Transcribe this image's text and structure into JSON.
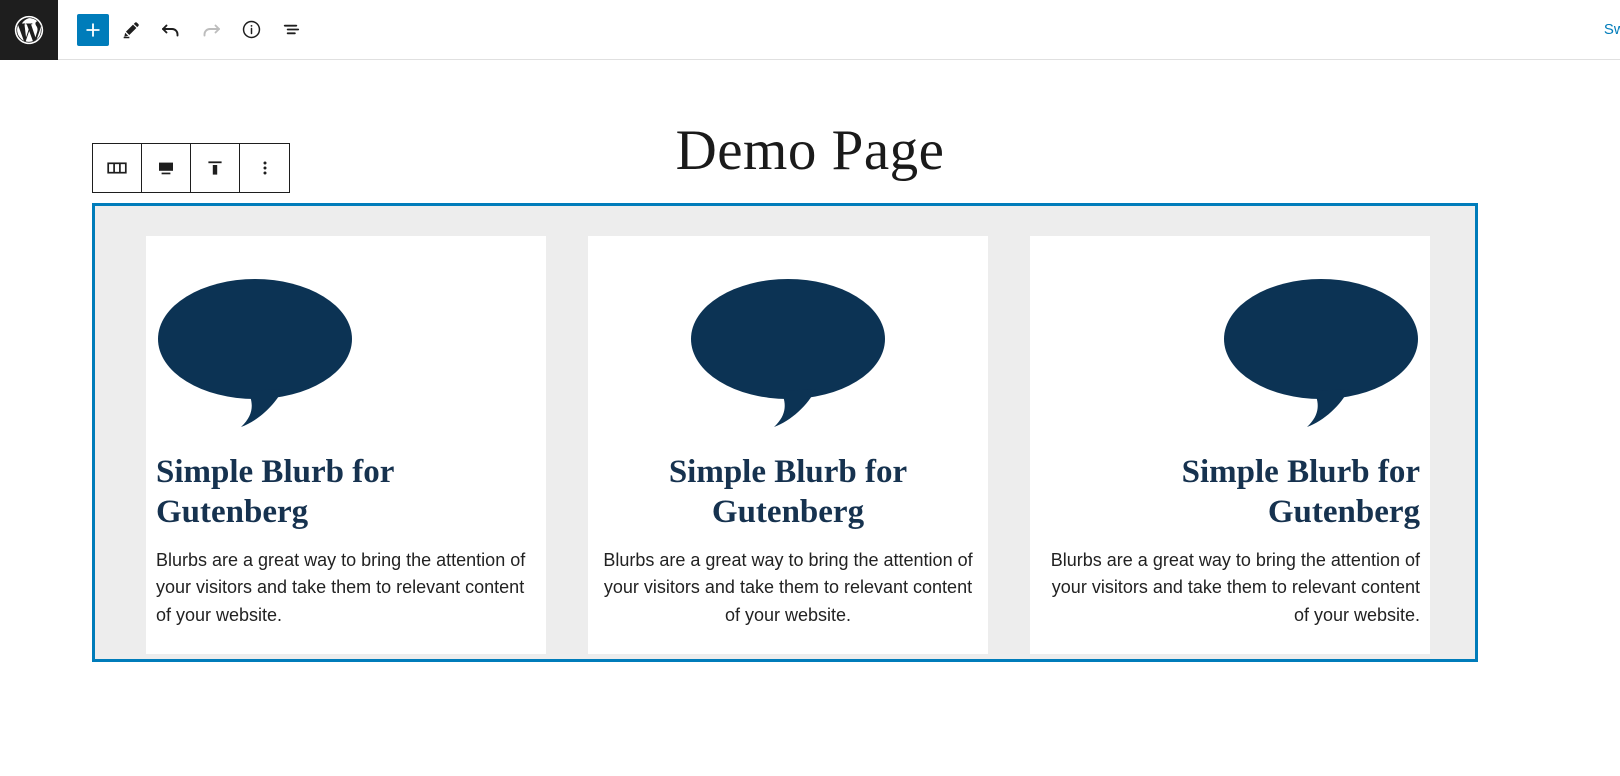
{
  "header": {
    "logo_icon": "wordpress-logo-icon",
    "tools": [
      {
        "name": "add-block-button",
        "icon": "plus-icon",
        "label": "Add block",
        "state": "primary"
      },
      {
        "name": "edit-tool-button",
        "icon": "pencil-icon",
        "label": "Tools",
        "state": "default"
      },
      {
        "name": "undo-button",
        "icon": "undo-arrow-icon",
        "label": "Undo",
        "state": "default"
      },
      {
        "name": "redo-button",
        "icon": "redo-arrow-icon",
        "label": "Redo",
        "state": "disabled"
      },
      {
        "name": "details-button",
        "icon": "info-circle-icon",
        "label": "Details",
        "state": "default"
      },
      {
        "name": "list-view-button",
        "icon": "list-view-icon",
        "label": "List view",
        "state": "default"
      }
    ],
    "switch_link": "Switch",
    "accent_color": "#007cba",
    "logo_background": "#1e1e1e"
  },
  "block_toolbar": {
    "buttons": [
      {
        "name": "block-type-columns-button",
        "icon": "columns-icon",
        "label": "Columns"
      },
      {
        "name": "change-alignment-button",
        "icon": "align-center-icon",
        "label": "Change alignment"
      },
      {
        "name": "vertical-align-button",
        "icon": "vertical-align-top-icon",
        "label": "Change vertical alignment"
      },
      {
        "name": "more-options-button",
        "icon": "ellipsis-vertical-icon",
        "label": "Options"
      }
    ]
  },
  "document": {
    "title": "Demo Page"
  },
  "columns_block": {
    "selected": true,
    "selection_color": "#007cba",
    "background_color": "#ededed",
    "columns": [
      {
        "name": "blurb-column-1",
        "alignment": "left",
        "icon": "speech-bubble-icon",
        "icon_color": "#0c3354",
        "title": "Simple Blurb for Gutenberg",
        "text": "Blurbs are a great way to bring the attention of your visitors and take them to relevant content of your website."
      },
      {
        "name": "blurb-column-2",
        "alignment": "center",
        "icon": "speech-bubble-icon",
        "icon_color": "#0c3354",
        "title": "Simple Blurb for Gutenberg",
        "text": "Blurbs are a great way to bring the attention of your visitors and take them to relevant content of your website."
      },
      {
        "name": "blurb-column-3",
        "alignment": "right",
        "icon": "speech-bubble-icon",
        "icon_color": "#0c3354",
        "title": "Simple Blurb for Gutenberg",
        "text": "Blurbs are a great way to bring the attention of your visitors and take them to relevant content of your website."
      }
    ]
  }
}
